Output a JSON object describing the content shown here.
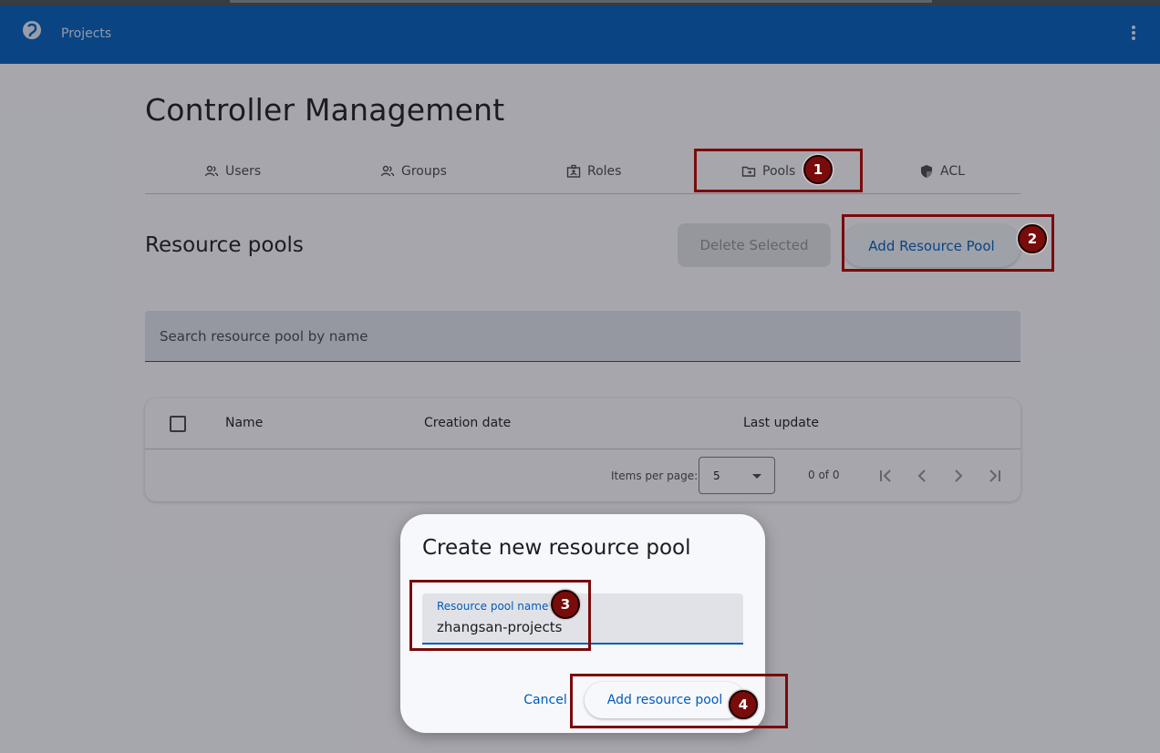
{
  "appbar": {
    "title": "Projects"
  },
  "page": {
    "title": "Controller Management"
  },
  "tabs": [
    {
      "label": "Users",
      "icon": "users-icon"
    },
    {
      "label": "Groups",
      "icon": "groups-icon"
    },
    {
      "label": "Roles",
      "icon": "roles-icon"
    },
    {
      "label": "Pools",
      "icon": "folder-icon"
    },
    {
      "label": "ACL",
      "icon": "shield-icon"
    }
  ],
  "section": {
    "title": "Resource pools",
    "delete_label": "Delete Selected",
    "add_label": "Add Resource Pool"
  },
  "search": {
    "placeholder": "Search resource pool by name"
  },
  "table": {
    "columns": [
      "Name",
      "Creation date",
      "Last update"
    ],
    "items_per_page_label": "Items per page:",
    "items_per_page": "5",
    "range": "0 of 0"
  },
  "dialog": {
    "title": "Create new resource pool",
    "field_label": "Resource pool name*",
    "field_value": "zhangsan-projects",
    "cancel_label": "Cancel",
    "submit_label": "Add resource pool"
  },
  "steps": [
    "1",
    "2",
    "3",
    "4"
  ],
  "colors": {
    "primary": "#005cbb",
    "marker": "#7a0b0b"
  }
}
